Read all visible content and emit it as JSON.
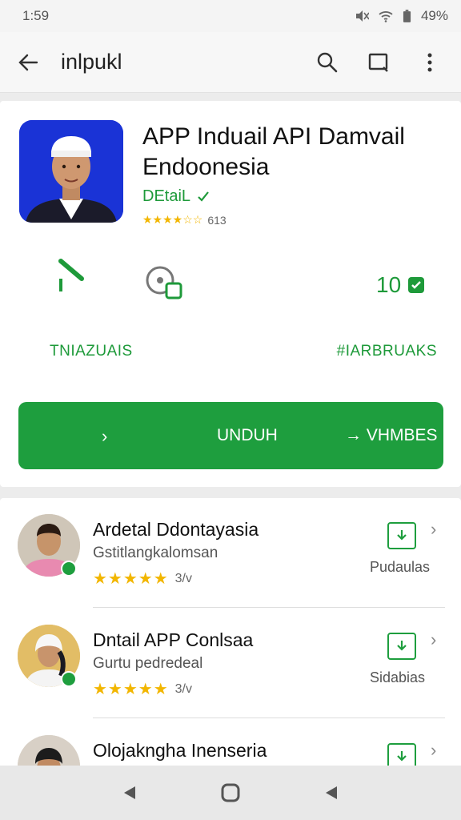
{
  "status": {
    "time": "1:59",
    "battery": "49%"
  },
  "toolbar": {
    "title": "inlpukl",
    "back_icon": "back-arrow-icon",
    "search_icon": "search-icon",
    "share_icon": "cast-icon",
    "more_icon": "more-vert-icon"
  },
  "app": {
    "title": "APP Induail API Damvail Endoonesia",
    "developer": "DEtaiL",
    "rating_stars": "★★★★☆☆",
    "rating_count": "613",
    "stat_value": "10",
    "stat_left_label": "TNIAZUAIS",
    "stat_right_label": "#IARBRUAKS",
    "install_chevron": "›",
    "install_label": "UNDUH",
    "more_label": "→ VHMBES"
  },
  "list": [
    {
      "name": "Ardetal Ddontayasia",
      "subtitle": "Gstitlangkalomsan",
      "stars": "★★★★★",
      "rating": "3/v",
      "action": "Pudaulas"
    },
    {
      "name": "Dntail APP Conlsaa",
      "subtitle": "Gurtu pedredeal",
      "stars": "★★★★★",
      "rating": "3/v",
      "action": "Sidabias"
    },
    {
      "name": "Olojakngha Inenseria",
      "subtitle": "",
      "stars": "",
      "rating": "",
      "action": ""
    }
  ],
  "colors": {
    "accent": "#1e9e3e",
    "star": "#f2b600",
    "app_icon_bg": "#1a33d6"
  }
}
